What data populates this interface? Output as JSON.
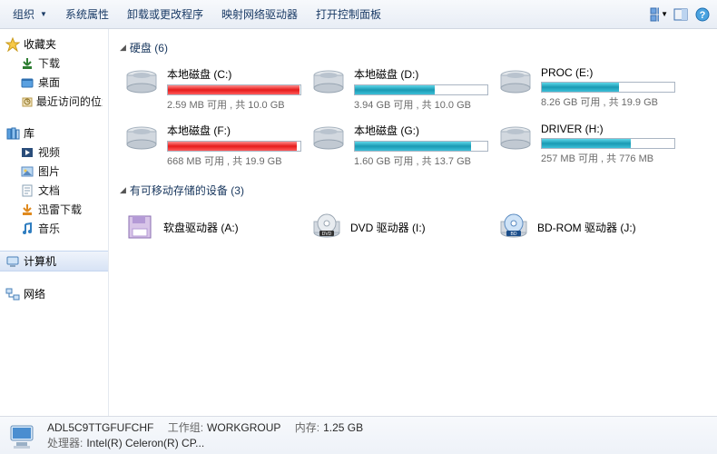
{
  "toolbar": {
    "organize": "组织",
    "system_properties": "系统属性",
    "uninstall_change": "卸载或更改程序",
    "map_network_drive": "映射网络驱动器",
    "open_control_panel": "打开控制面板"
  },
  "sidebar": {
    "favorites": {
      "label": "收藏夹",
      "items": [
        "下载",
        "桌面",
        "最近访问的位置"
      ]
    },
    "libraries": {
      "label": "库",
      "items": [
        "视频",
        "图片",
        "文档",
        "迅雷下载",
        "音乐"
      ]
    },
    "computer": {
      "label": "计算机"
    },
    "network": {
      "label": "网络"
    }
  },
  "groups": {
    "hdd": {
      "label": "硬盘",
      "count": 6
    },
    "removable": {
      "label": "有可移动存储的设备",
      "count": 3
    }
  },
  "drives": [
    {
      "name": "本地磁盘 (C:)",
      "sub": "2.59 MB 可用 , 共 10.0 GB",
      "fill": 99,
      "color": "red"
    },
    {
      "name": "本地磁盘 (D:)",
      "sub": "3.94 GB 可用 , 共 10.0 GB",
      "fill": 60,
      "color": "blue"
    },
    {
      "name": "PROC (E:)",
      "sub": "8.26 GB 可用 , 共 19.9 GB",
      "fill": 58,
      "color": "blue"
    },
    {
      "name": "本地磁盘 (F:)",
      "sub": "668 MB 可用 , 共 19.9 GB",
      "fill": 97,
      "color": "red"
    },
    {
      "name": "本地磁盘 (G:)",
      "sub": "1.60 GB 可用 , 共 13.7 GB",
      "fill": 88,
      "color": "blue"
    },
    {
      "name": "DRIVER (H:)",
      "sub": "257 MB 可用 , 共 776 MB",
      "fill": 67,
      "color": "blue"
    }
  ],
  "removables": [
    {
      "name": "软盘驱动器 (A:)",
      "kind": "floppy"
    },
    {
      "name": "DVD 驱动器 (I:)",
      "kind": "dvd"
    },
    {
      "name": "BD-ROM 驱动器 (J:)",
      "kind": "bd"
    }
  ],
  "status": {
    "computer_name": "ADL5C9TTGFUFCHF",
    "workgroup_label": "工作组:",
    "workgroup": "WORKGROUP",
    "memory_label": "内存:",
    "memory": "1.25 GB",
    "processor_label": "处理器:",
    "processor": "Intel(R) Celeron(R) CP..."
  }
}
